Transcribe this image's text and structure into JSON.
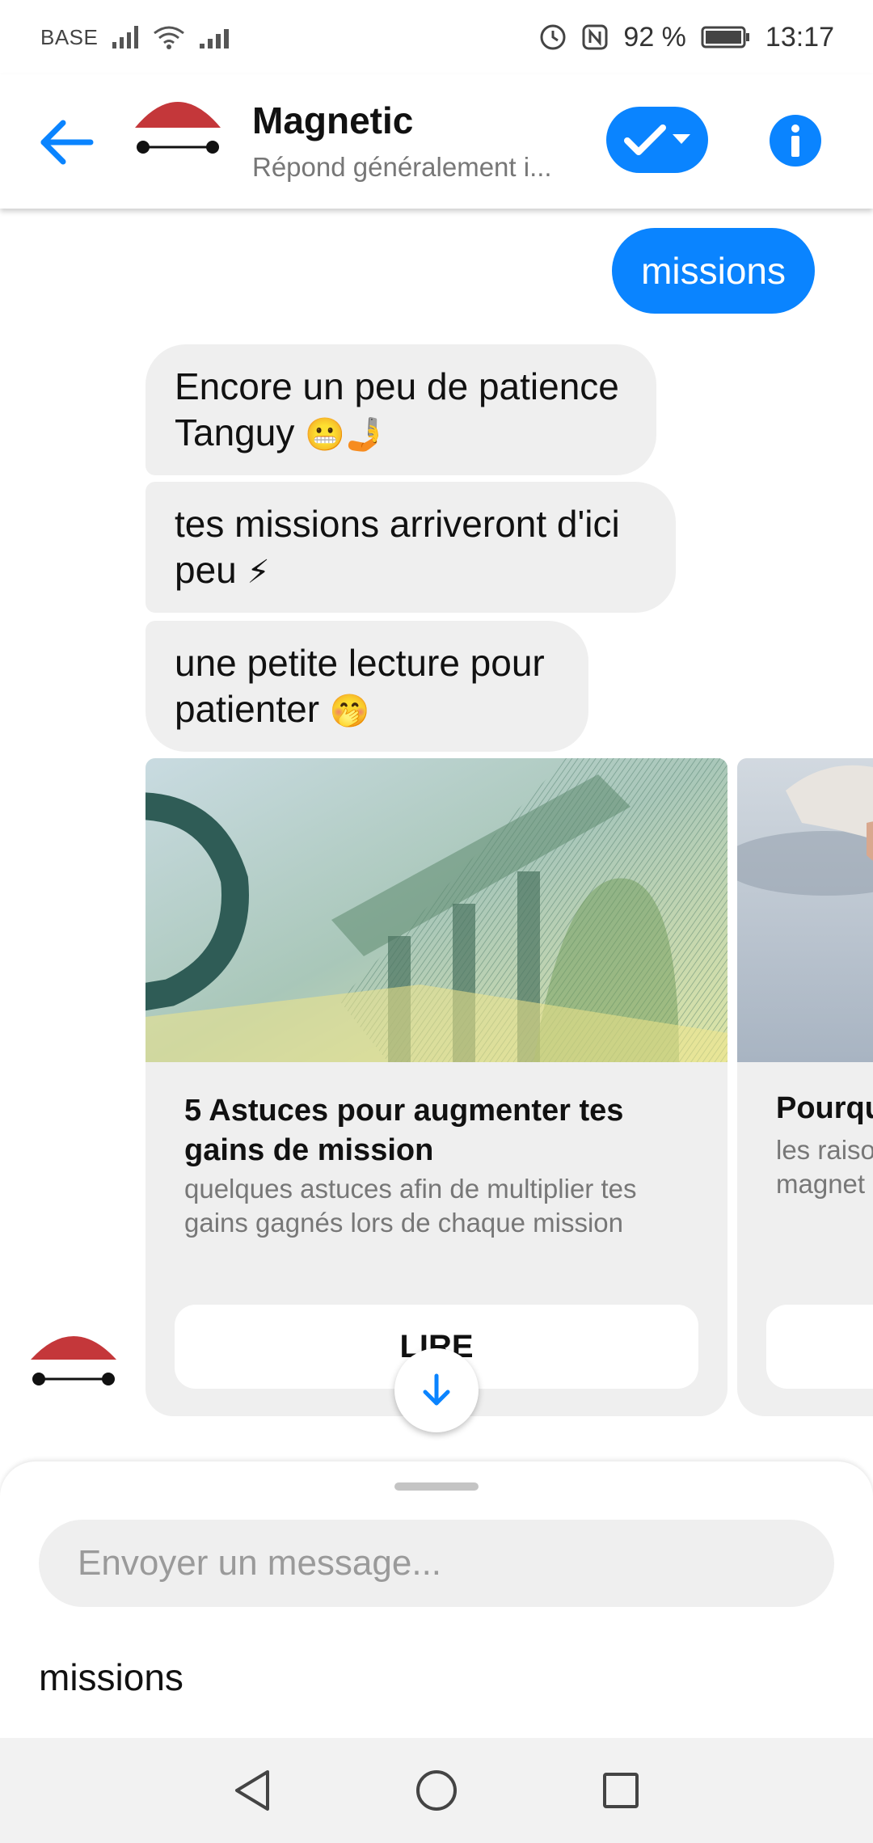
{
  "status_bar": {
    "carrier": "BASE",
    "battery": "92 %",
    "time": "13:17"
  },
  "header": {
    "title": "Magnetic",
    "subtitle": "Répond généralement i..."
  },
  "messages": {
    "outgoing": "missions",
    "incoming_1_text": "Encore un peu de patience Tanguy",
    "incoming_1_emoji": "😬🤳",
    "incoming_2_text": "tes missions arriveront d'ici peu",
    "incoming_2_emoji": "⚡",
    "incoming_3_text": "une petite lecture pour patienter",
    "incoming_3_emoji": "🤭"
  },
  "cards": [
    {
      "title": "5 Astuces pour augmenter tes gains de mission",
      "description": "quelques astuces afin de multiplier tes gains gagnés lors de chaque mission",
      "button": "LIRE"
    },
    {
      "title": "Pourqu",
      "description_line_1": "les raiso",
      "description_line_2": "magnet"
    }
  ],
  "composer": {
    "placeholder": "Envoyer un message...",
    "suggestion": "missions"
  },
  "colors": {
    "accent": "#0a84ff",
    "brand_red": "#c4373a",
    "bubble_gray": "#efefef"
  }
}
